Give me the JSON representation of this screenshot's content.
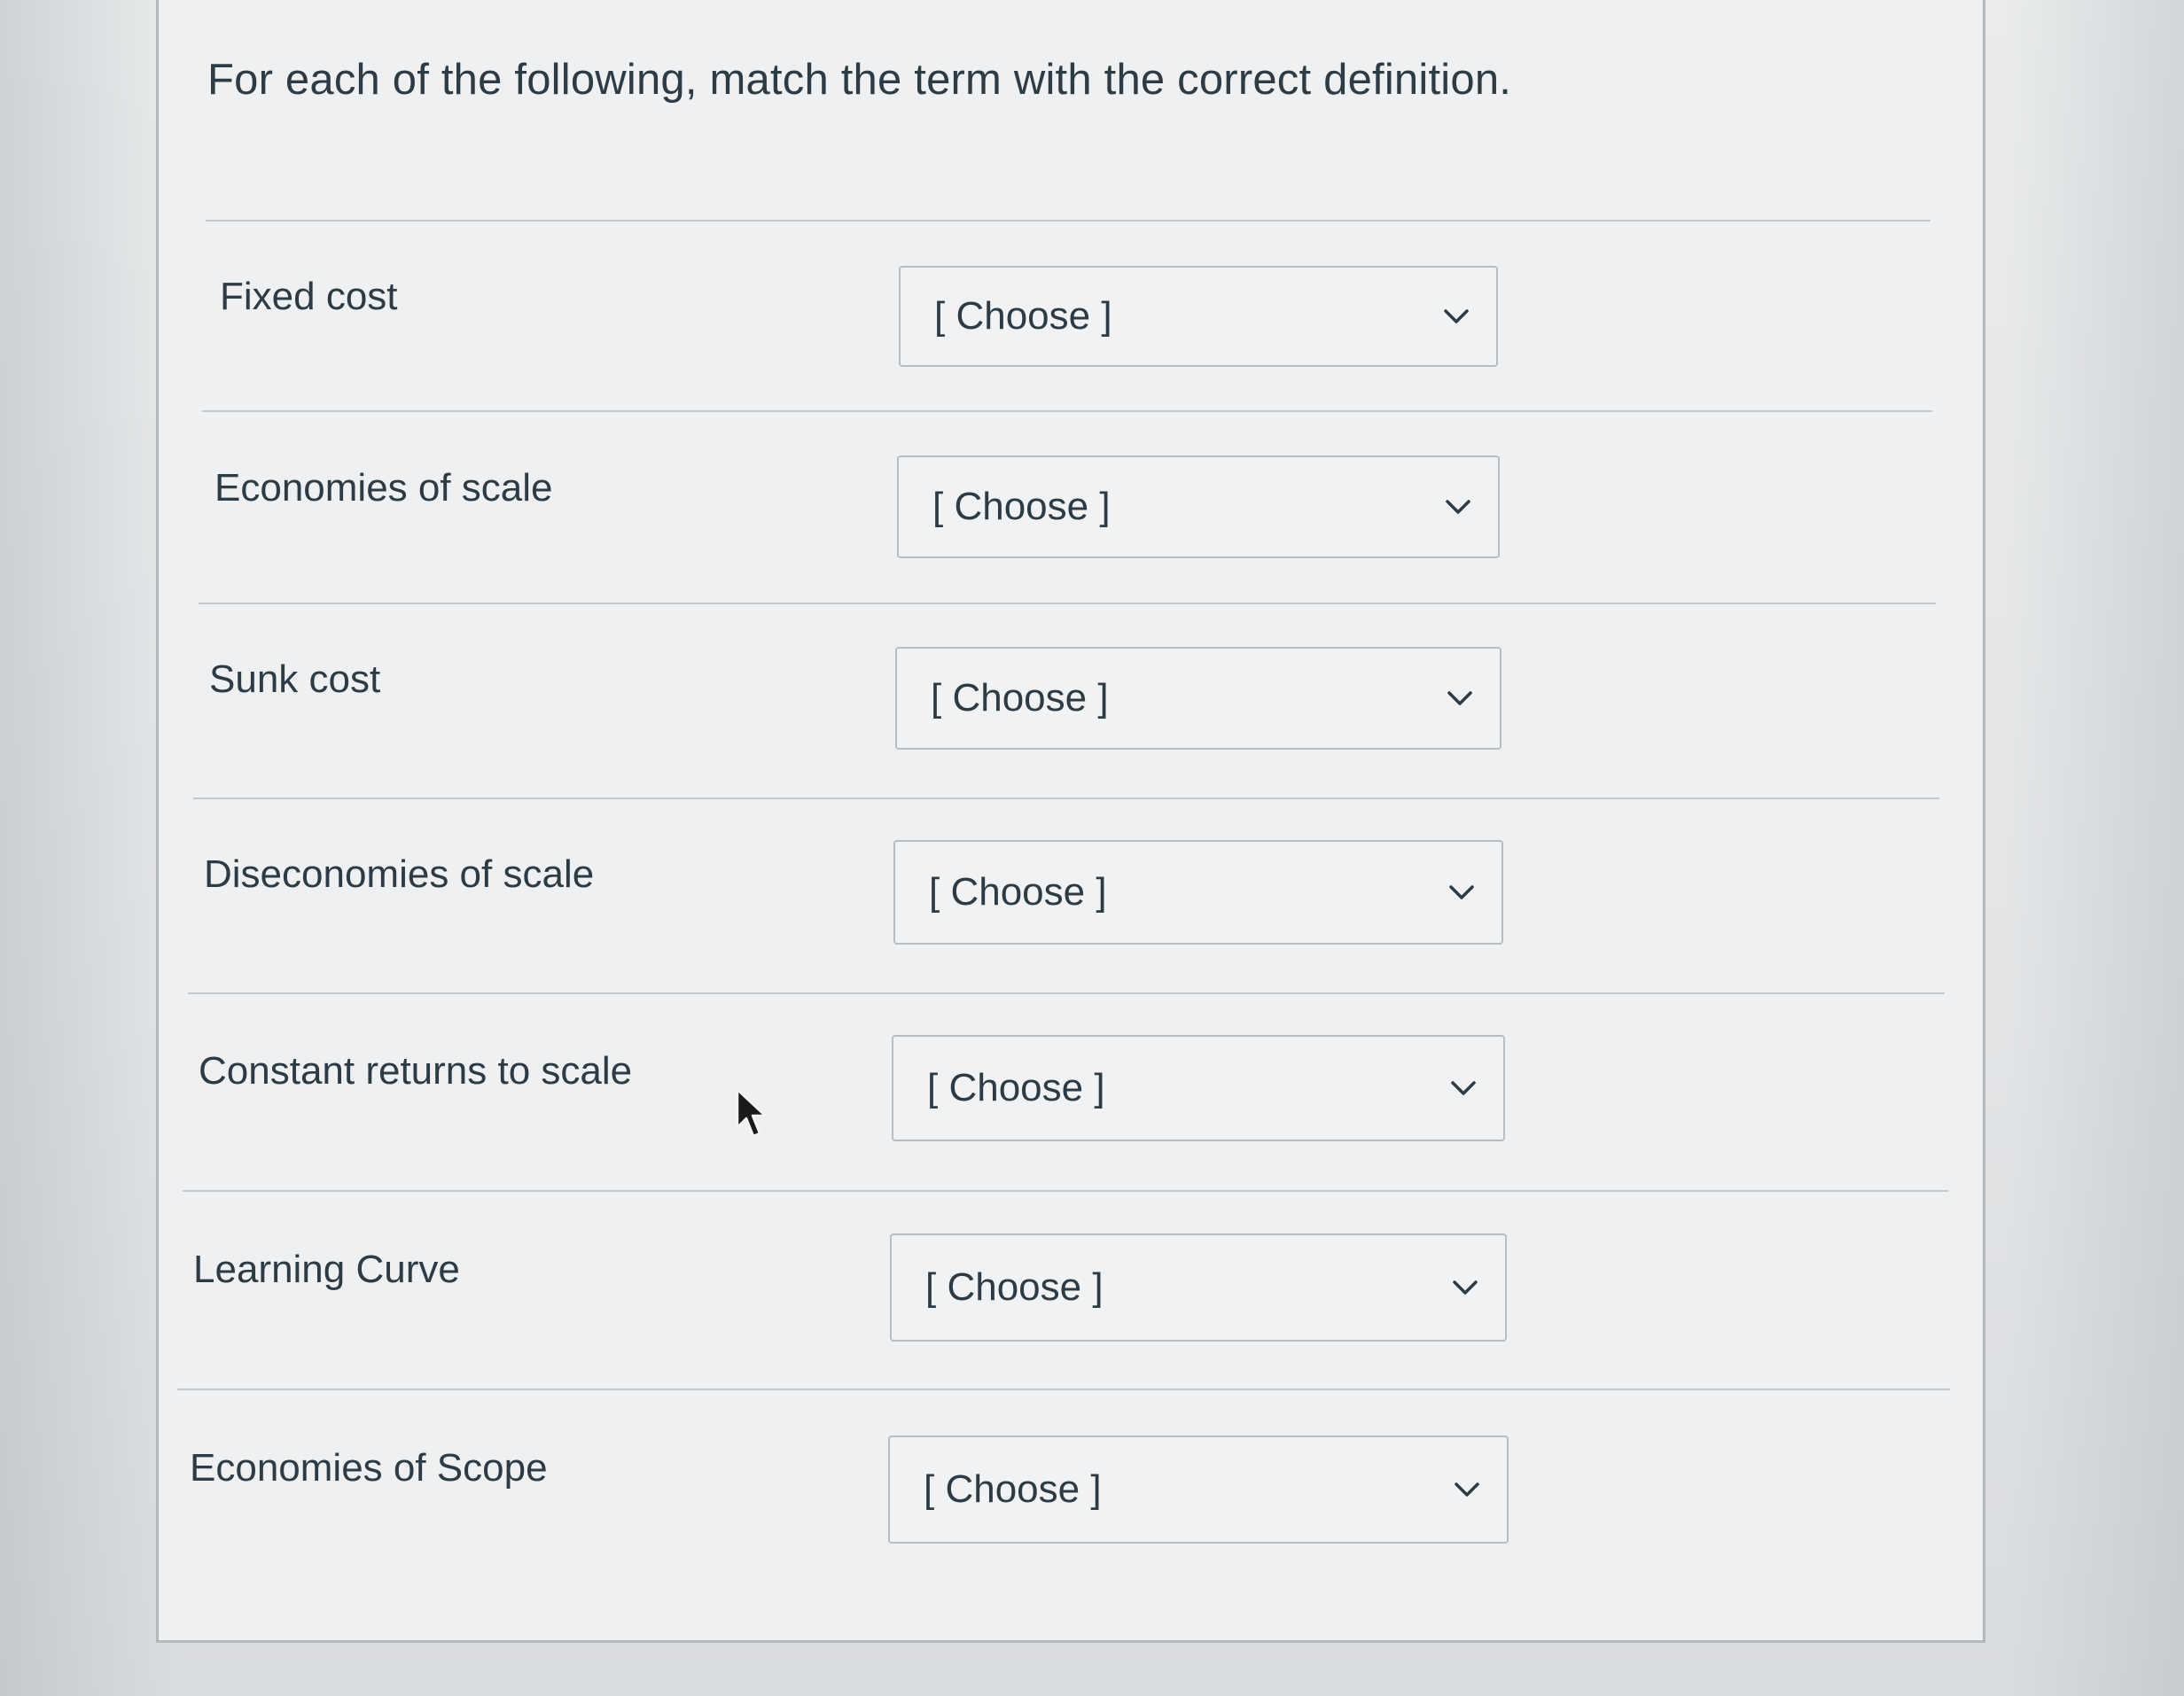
{
  "question": {
    "prompt": "For each of the following, match the term with the correct definition."
  },
  "rows": [
    {
      "term": "Fixed cost",
      "select_value": "[ Choose ]"
    },
    {
      "term": "Economies of scale",
      "select_value": "[ Choose ]"
    },
    {
      "term": "Sunk cost",
      "select_value": "[ Choose ]"
    },
    {
      "term": "Diseconomies of scale",
      "select_value": "[ Choose ]"
    },
    {
      "term": "Constant returns to scale",
      "select_value": "[ Choose ]"
    },
    {
      "term": "Learning Curve",
      "select_value": "[ Choose ]"
    },
    {
      "term": "Economies of Scope",
      "select_value": "[ Choose ]"
    }
  ],
  "icons": {
    "dropdown": "chevron-down-icon",
    "pointer": "mouse-cursor-icon"
  },
  "colors": {
    "text": "#2d3b45",
    "panel_background": "#eff0f1",
    "select_border": "#b8bdc2",
    "divider": "#c5c9cd"
  }
}
